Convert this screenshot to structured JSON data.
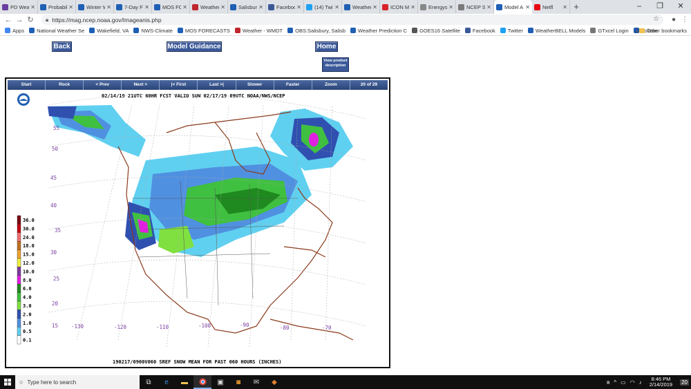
{
  "browser": {
    "tabs": [
      {
        "title": "PD Weat",
        "fav_color": "#6a3fa0"
      },
      {
        "title": "Probabil",
        "fav_color": "#1f5fb4"
      },
      {
        "title": "Winter W",
        "fav_color": "#1f5fb4"
      },
      {
        "title": "7-Day Fo",
        "fav_color": "#1f5fb4"
      },
      {
        "title": "MOS FO",
        "fav_color": "#1f5fb4"
      },
      {
        "title": "Weather",
        "fav_color": "#c0262d"
      },
      {
        "title": "Salisbury",
        "fav_color": "#1f5fb4"
      },
      {
        "title": "Faceboo",
        "fav_color": "#3b5998"
      },
      {
        "title": "(14) Twit",
        "fav_color": "#1da1f2"
      },
      {
        "title": "Weather",
        "fav_color": "#1f5fb4"
      },
      {
        "title": "ICON Mo",
        "fav_color": "#d8232a"
      },
      {
        "title": "Energysu",
        "fav_color": "#888888"
      },
      {
        "title": "NCEP SR",
        "fav_color": "#7a7a7a"
      },
      {
        "title": "Model A",
        "fav_color": "#1f5fb4",
        "active": true
      },
      {
        "title": "Netfl",
        "fav_color": "#e50914"
      }
    ],
    "url": "https://mag.ncep.noaa.gov/Imageanis.php",
    "bookmarks": [
      {
        "label": "Apps",
        "fav_color": "#4285f4"
      },
      {
        "label": "National Weather Se",
        "fav_color": "#1f5fb4"
      },
      {
        "label": "Wakefield, VA",
        "fav_color": "#1f5fb4"
      },
      {
        "label": "NWS-Climate",
        "fav_color": "#1f5fb4"
      },
      {
        "label": "MOS FORECASTS",
        "fav_color": "#1f5fb4"
      },
      {
        "label": "Weather - WMDT",
        "fav_color": "#c0262d"
      },
      {
        "label": "OBS:Salisbury, Salisb",
        "fav_color": "#1f5fb4"
      },
      {
        "label": "Weather Prediction C",
        "fav_color": "#1f5fb4"
      },
      {
        "label": "GOES16 Satellite",
        "fav_color": "#555555"
      },
      {
        "label": "Facebook",
        "fav_color": "#3b5998"
      },
      {
        "label": "Twitter",
        "fav_color": "#1da1f2"
      },
      {
        "label": "WeatherBELL Models",
        "fav_color": "#1f5fb4"
      },
      {
        "label": "GTxcel Login",
        "fav_color": "#777777"
      },
      {
        "label": "Volicon",
        "fav_color": "#2255aa"
      }
    ],
    "bookmarks_more": "»",
    "other_bookmarks": "Other bookmarks"
  },
  "page": {
    "back_label": "Back",
    "model_guidance_label": "Model Guidance",
    "home_label": "Home",
    "view_description_label": "View product description",
    "controls": [
      "Start",
      "Rock",
      "< Prev",
      "Next >",
      "|< First",
      "Last >|",
      "Slower",
      "Faster",
      "Zoom",
      "20 of 29"
    ],
    "map": {
      "header": "02/14/19 21UTC  60HR  FCST VALID SUN 02/17/19 09UTC  NOAA/NWS/NCEP",
      "footer": "190217/0900V060 SREF SNOW MEAN FOR PAST 060 HOURS (INCHES)",
      "lat_labels": [
        "55",
        "50",
        "45",
        "40",
        "35",
        "30",
        "25",
        "20",
        "15"
      ],
      "lon_labels": [
        "-130",
        "-120",
        "-110",
        "-100",
        "-90",
        "-80",
        "-70"
      ],
      "legend": [
        {
          "value": "36.0",
          "color": "#7a0010"
        },
        {
          "value": "30.0",
          "color": "#c40010"
        },
        {
          "value": "24.0",
          "color": "#f07070"
        },
        {
          "value": "18.0",
          "color": "#c07020"
        },
        {
          "value": "15.0",
          "color": "#f0a030"
        },
        {
          "value": "12.0",
          "color": "#f0f040"
        },
        {
          "value": "10.0",
          "color": "#7a3aa0"
        },
        {
          "value": "8.0",
          "color": "#e020e0"
        },
        {
          "value": "6.0",
          "color": "#1f8a1f"
        },
        {
          "value": "4.0",
          "color": "#40c040"
        },
        {
          "value": "3.0",
          "color": "#80e040"
        },
        {
          "value": "2.0",
          "color": "#3050b0"
        },
        {
          "value": "1.0",
          "color": "#5090e0"
        },
        {
          "value": "0.5",
          "color": "#60d0f0"
        },
        {
          "value": "0.1",
          "color": "#ffffff"
        }
      ]
    }
  },
  "taskbar": {
    "search_placeholder": "Type here to search",
    "time": "8:46 PM",
    "date": "2/14/2019",
    "notification_count": "20"
  }
}
